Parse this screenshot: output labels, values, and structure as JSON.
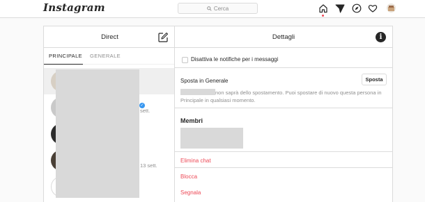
{
  "topbar": {
    "logo": "Instagram",
    "search_placeholder": "Cerca",
    "icons": [
      "home-icon",
      "direct-icon",
      "explore-icon",
      "heart-icon",
      "profile-avatar"
    ]
  },
  "direct": {
    "title": "Direct",
    "tabs": [
      {
        "label": "PRINCIPALE",
        "active": true
      },
      {
        "label": "GENERALE",
        "active": false
      }
    ],
    "threads": [
      {
        "meta": ""
      },
      {
        "meta": "sett."
      },
      {
        "meta": ""
      },
      {
        "meta": "13 sett."
      },
      {
        "meta": ""
      }
    ]
  },
  "details": {
    "title": "Dettagli",
    "mute_label": "Disattiva le notifiche per i messaggi",
    "move_label": "Sposta in Generale",
    "move_button": "Sposta",
    "move_description": "non saprà dello spostamento. Puoi spostare di nuovo questa persona in Principale in qualsiasi momento.",
    "members_label": "Membri",
    "actions": [
      "Elimina chat",
      "Blocca",
      "Segnala"
    ]
  },
  "colors": {
    "danger": "#ed4956",
    "verified": "#3897f0",
    "border": "#dbdbdb"
  }
}
